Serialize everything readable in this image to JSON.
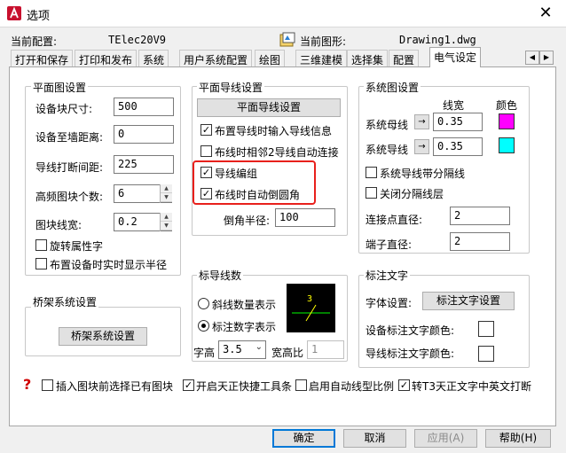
{
  "window": {
    "title": "选项",
    "close_glyph": "✕"
  },
  "header": {
    "current_profile_label": "当前配置:",
    "current_profile_value": "TElec20V9",
    "current_drawing_label": "当前图形:",
    "current_drawing_value": "Drawing1.dwg"
  },
  "tabs": [
    {
      "label": "打开和保存"
    },
    {
      "label": "打印和发布"
    },
    {
      "label": "系统"
    },
    {
      "label": "用户系统配置"
    },
    {
      "label": "绘图"
    },
    {
      "label": "三维建模"
    },
    {
      "label": "选择集"
    },
    {
      "label": "配置"
    },
    {
      "label": "电气设定",
      "active": true
    }
  ],
  "tab_scroll": {
    "left": "◀",
    "right": "▶"
  },
  "plan_settings": {
    "title": "平面图设置",
    "device_block_size_label": "设备块尺寸:",
    "device_block_size": "500",
    "device_wall_dist_label": "设备至墙距离:",
    "device_wall_dist": "0",
    "wire_break_gap_label": "导线打断间距:",
    "wire_break_gap": "225",
    "hf_block_count_label": "高频图块个数:",
    "hf_block_count": "6",
    "block_linewidth_label": "图块线宽:",
    "block_linewidth": "0.2",
    "rotate_attr_label": "旋转属性字",
    "rotate_attr_checked": false,
    "show_radius_label": "布置设备时实时显示半径",
    "show_radius_checked": false
  },
  "wire_settings": {
    "title": "平面导线设置",
    "button_label": "平面导线设置",
    "options": [
      {
        "label": "布置导线时输入导线信息",
        "checked": true
      },
      {
        "label": "布线时相邻2导线自动连接",
        "checked": false
      },
      {
        "label": "导线编组",
        "checked": true
      },
      {
        "label": "布线时自动倒圆角",
        "checked": true
      }
    ],
    "fillet_radius_label": "倒角半径:",
    "fillet_radius": "100"
  },
  "system_settings": {
    "title": "系统图设置",
    "linewidth_header": "线宽",
    "color_header": "颜色",
    "bus_label": "系统母线",
    "bus_width": "0.35",
    "bus_color": "#ff00ff",
    "wire_label": "系统导线",
    "wire_width": "0.35",
    "wire_color": "#00ffff",
    "arrow_glyph": "→",
    "separator_label": "系统导线带分隔线",
    "separator_checked": false,
    "close_layer_label": "关闭分隔线层",
    "close_layer_checked": false,
    "junction_dia_label": "连接点直径:",
    "junction_dia": "2",
    "terminal_dia_label": "端子直径:",
    "terminal_dia": "2"
  },
  "wire_count": {
    "title": "标导线数",
    "oblique_label": "斜线数量表示",
    "oblique_selected": false,
    "number_label": "标注数字表示",
    "number_selected": true,
    "preview_number": "3",
    "font_height_label": "字高",
    "font_height": "3.5",
    "aspect_label": "宽高比",
    "aspect": "1"
  },
  "annotation": {
    "title": "标注文字",
    "font_setting_label": "字体设置:",
    "font_button": "标注文字设置",
    "device_color_label": "设备标注文字颜色:",
    "wire_color_label": "导线标注文字颜色:"
  },
  "bridge": {
    "title": "桥架系统设置",
    "button": "桥架系统设置"
  },
  "bottom_options": {
    "help_glyph": "?",
    "items": [
      {
        "label": "插入图块前选择已有图块",
        "checked": false
      },
      {
        "label": "开启天正快捷工具条",
        "checked": true
      },
      {
        "label": "启用自动线型比例",
        "checked": false
      },
      {
        "label": "转T3天正文字中英文打断",
        "checked": true
      }
    ]
  },
  "footer": {
    "ok": "确定",
    "cancel": "取消",
    "apply": "应用(A)",
    "help": "帮助(H)"
  }
}
